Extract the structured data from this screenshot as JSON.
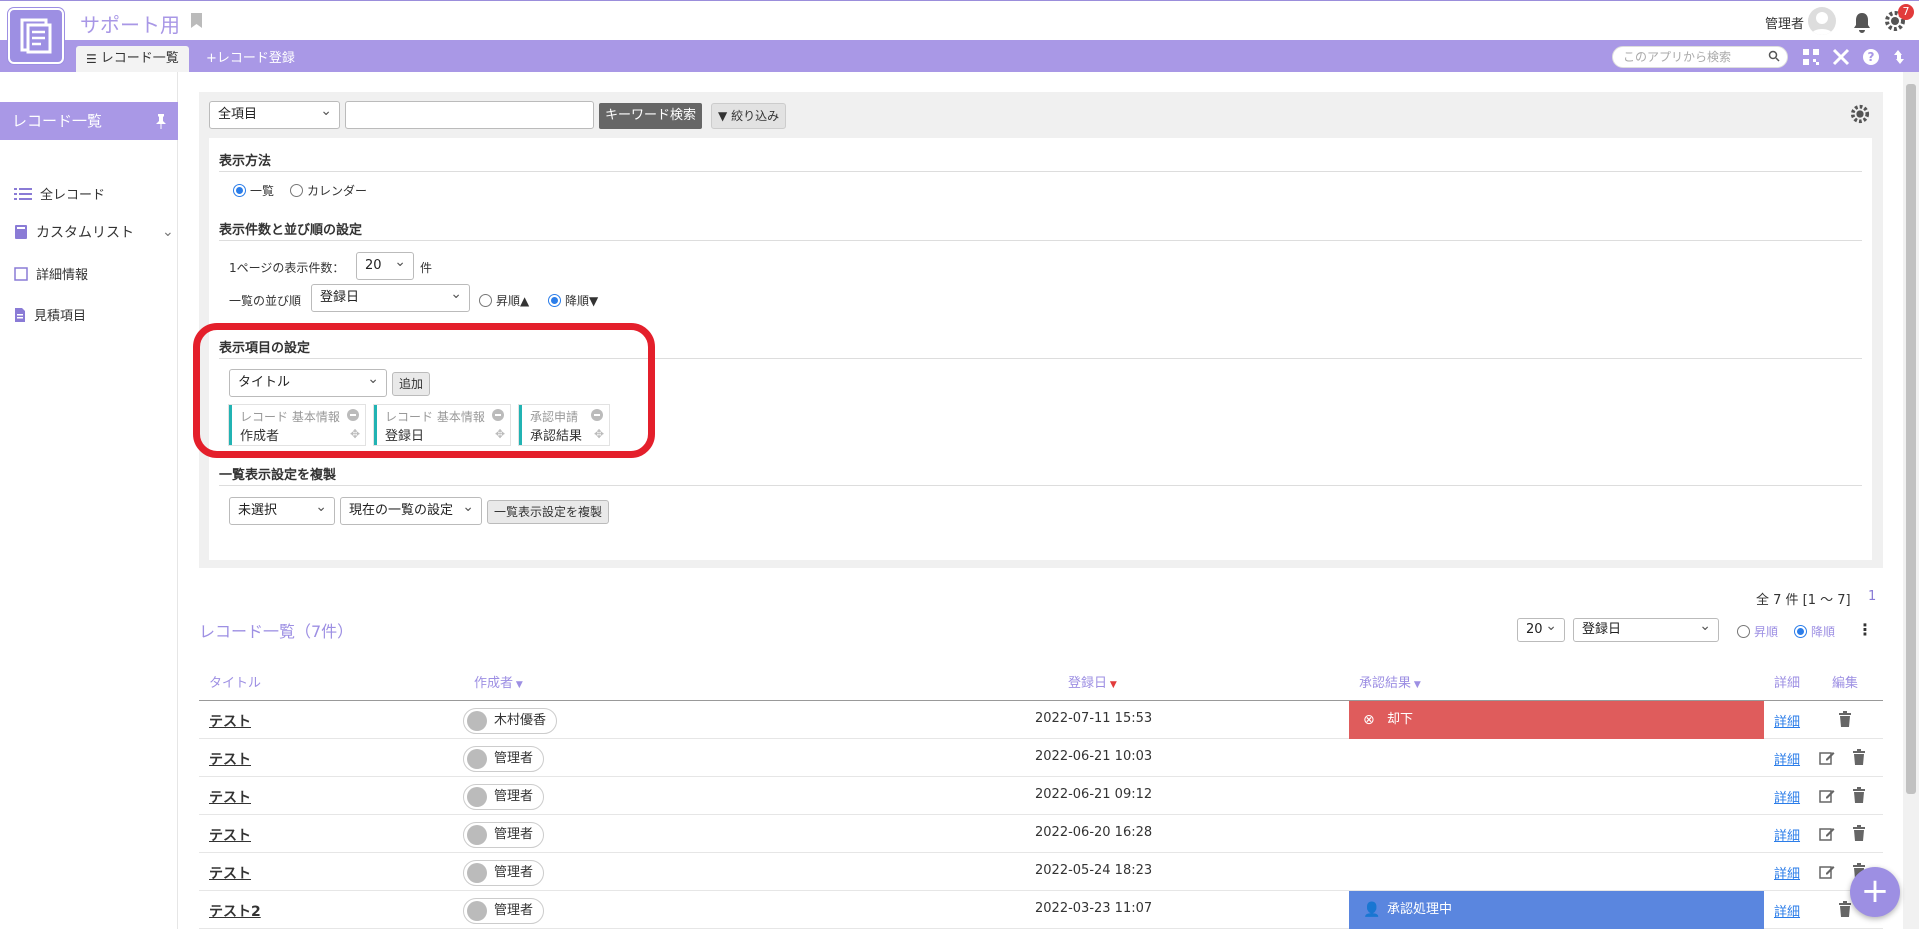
{
  "app": {
    "title": "サポート用"
  },
  "header": {
    "user_name": "管理者",
    "notification_badge": "7"
  },
  "nav": {
    "tab_list": "レコード一覧",
    "tab_register": "+レコード登録",
    "search_placeholder": "このアプリから検索"
  },
  "sidebar": {
    "title": "レコード一覧",
    "items": [
      {
        "label": "全レコード",
        "icon": "list-icon"
      },
      {
        "label": "カスタムリスト",
        "icon": "book-icon"
      },
      {
        "label": "詳細情報",
        "icon": "square-icon"
      },
      {
        "label": "見積項目",
        "icon": "document-icon"
      }
    ]
  },
  "filter": {
    "field_select": "全項目",
    "keyword_value": "",
    "keyword_button": "キーワード検索",
    "narrow_button": "絞り込み"
  },
  "display_method": {
    "title": "表示方法",
    "options": [
      "一覧",
      "カレンダー"
    ],
    "selected": "一覧"
  },
  "count_sort": {
    "title": "表示件数と並び順の設定",
    "per_page_label": "1ページの表示件数：",
    "per_page_value": "20",
    "per_page_unit": "件",
    "order_label": "一覧の並び順",
    "order_field": "登録日",
    "asc_label": "昇順▲",
    "desc_label": "降順▼",
    "selected": "desc"
  },
  "display_items": {
    "title": "表示項目の設定",
    "select_value": "タイトル",
    "add_button": "追加",
    "chips": [
      {
        "category": "レコード 基本情報",
        "name": "作成者"
      },
      {
        "category": "レコード 基本情報",
        "name": "登録日"
      },
      {
        "category": "承認申請",
        "name": "承認結果"
      }
    ]
  },
  "copy_settings": {
    "title": "一覧表示設定を複製",
    "source_select": "未選択",
    "target_select": "現在の一覧の設定",
    "copy_button": "一覧表示設定を複製"
  },
  "records": {
    "summary": "全 7 件 [1 ～ 7]",
    "page": "1",
    "title": "レコード一覧（7件）",
    "per_page": "20",
    "sort_field": "登録日",
    "asc_label": "昇順",
    "desc_label": "降順",
    "columns": {
      "title": "タイトル",
      "author": "作成者",
      "date": "登録日",
      "result": "承認結果",
      "detail": "詳細",
      "edit": "編集"
    },
    "rows": [
      {
        "title": "テスト",
        "author": "木村優香",
        "date": "2022-07-11 15:53",
        "status": "却下",
        "detail": "詳細"
      },
      {
        "title": "テスト",
        "author": "管理者",
        "date": "2022-06-21 10:03",
        "status": "",
        "detail": "詳細"
      },
      {
        "title": "テスト",
        "author": "管理者",
        "date": "2022-06-21 09:12",
        "status": "",
        "detail": "詳細"
      },
      {
        "title": "テスト",
        "author": "管理者",
        "date": "2022-06-20 16:28",
        "status": "",
        "detail": "詳細"
      },
      {
        "title": "テスト",
        "author": "管理者",
        "date": "2022-05-24 18:23",
        "status": "",
        "detail": "詳細"
      },
      {
        "title": "テスト2",
        "author": "管理者",
        "date": "2022-03-23 11:07",
        "status": "承認処理中",
        "detail": "詳細"
      }
    ]
  },
  "colors": {
    "accent": "#a998e6",
    "rejected": "#df5c5c",
    "processing": "#5a86df",
    "highlight": "#e41f2b"
  }
}
